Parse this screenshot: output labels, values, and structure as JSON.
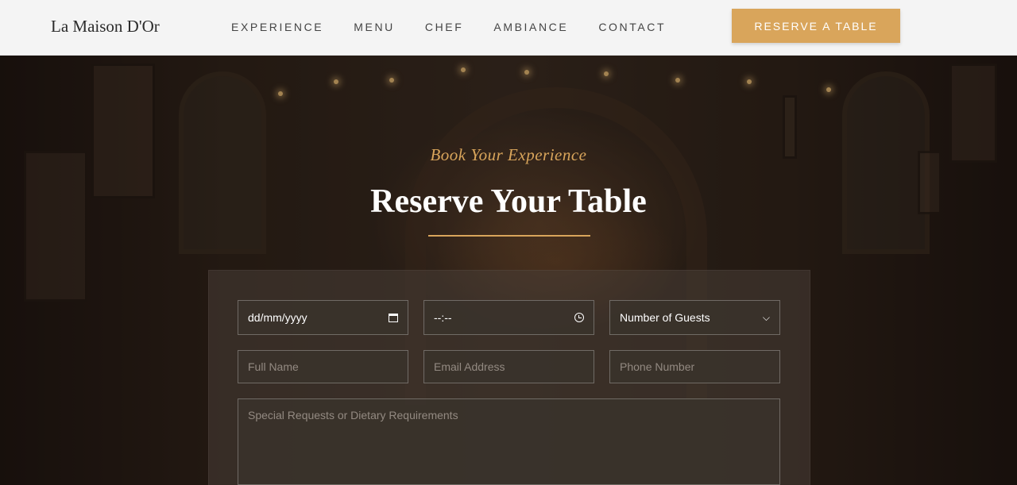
{
  "header": {
    "brand": "La Maison D'Or",
    "nav": [
      "EXPERIENCE",
      "MENU",
      "CHEF",
      "AMBIANCE",
      "CONTACT"
    ],
    "cta": "RESERVE A TABLE"
  },
  "hero": {
    "eyebrow": "Book Your Experience",
    "title": "Reserve Your Table"
  },
  "form": {
    "date_value": "dd/mm/yyyy",
    "time_value": "--:--",
    "guests_value": "Number of Guests",
    "name_placeholder": "Full Name",
    "email_placeholder": "Email Address",
    "phone_placeholder": "Phone Number",
    "requests_placeholder": "Special Requests or Dietary Requirements"
  },
  "colors": {
    "accent": "#d9a55b",
    "header_bg": "#f4f4f4",
    "field_border": "#8a817a"
  },
  "icons": [
    "calendar-icon",
    "clock-icon",
    "chevron-down-icon"
  ]
}
